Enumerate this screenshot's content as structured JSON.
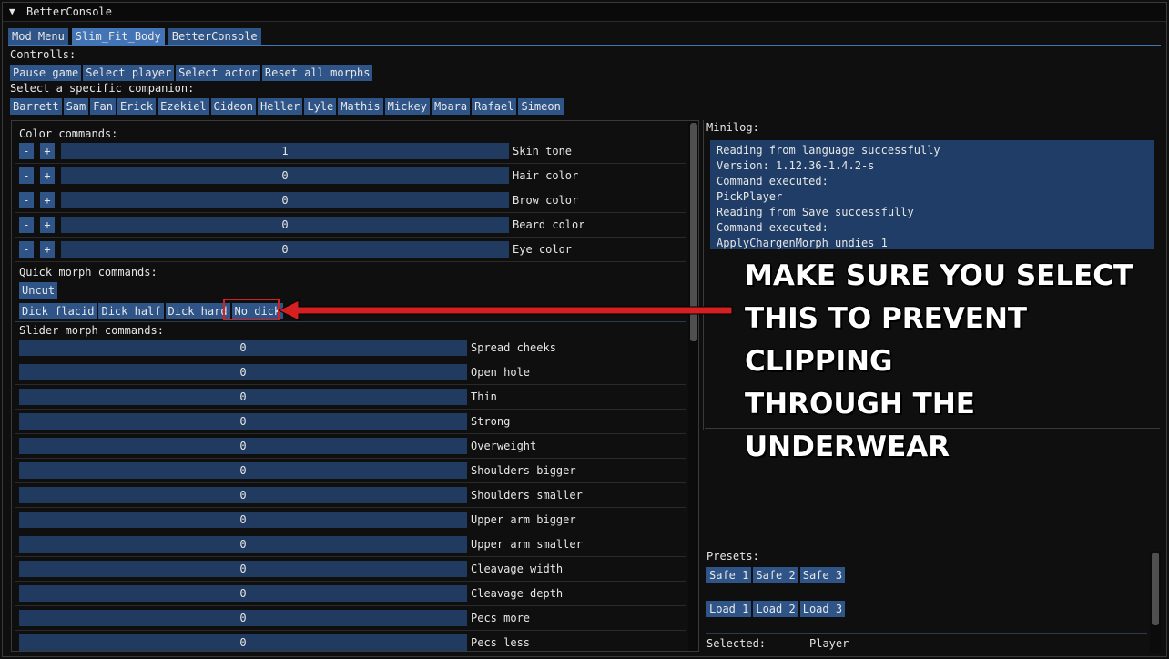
{
  "window": {
    "title": "BetterConsole",
    "collapse_icon": "triangle-down-icon"
  },
  "tabs": [
    {
      "label": "Mod Menu",
      "active": false
    },
    {
      "label": "Slim_Fit_Body",
      "active": true
    },
    {
      "label": "BetterConsole",
      "active": false
    }
  ],
  "controls": {
    "heading": "Controlls:",
    "buttons": [
      "Pause game",
      "Select player",
      "Select actor",
      "Reset all morphs"
    ],
    "companion_heading": "Select a specific companion:",
    "companions": [
      "Barrett",
      "Sam",
      "Fan",
      "Erick",
      "Ezekiel",
      "Gideon",
      "Heller",
      "Lyle",
      "Mathis",
      "Mickey",
      "Moara",
      "Rafael",
      "Simeon"
    ]
  },
  "color_section": {
    "heading": "Color commands:",
    "minus": "-",
    "plus": "+",
    "rows": [
      {
        "value": "1",
        "label": "Skin tone"
      },
      {
        "value": "0",
        "label": "Hair color"
      },
      {
        "value": "0",
        "label": "Brow color"
      },
      {
        "value": "0",
        "label": "Beard color"
      },
      {
        "value": "0",
        "label": "Eye color"
      }
    ]
  },
  "quick_morph": {
    "heading": "Quick morph commands:",
    "uncut": "Uncut",
    "buttons": [
      "Dick flacid",
      "Dick half",
      "Dick hard",
      "No dick"
    ]
  },
  "slider_section": {
    "heading": "Slider morph commands:",
    "rows": [
      {
        "value": "0",
        "label": "Spread cheeks"
      },
      {
        "value": "0",
        "label": "Open hole"
      },
      {
        "value": "0",
        "label": "Thin"
      },
      {
        "value": "0",
        "label": "Strong"
      },
      {
        "value": "0",
        "label": "Overweight"
      },
      {
        "value": "0",
        "label": "Shoulders bigger"
      },
      {
        "value": "0",
        "label": "Shoulders smaller"
      },
      {
        "value": "0",
        "label": "Upper arm bigger"
      },
      {
        "value": "0",
        "label": "Upper arm smaller"
      },
      {
        "value": "0",
        "label": "Cleavage width"
      },
      {
        "value": "0",
        "label": "Cleavage depth"
      },
      {
        "value": "0",
        "label": "Pecs more"
      },
      {
        "value": "0",
        "label": "Pecs less"
      }
    ]
  },
  "minilog": {
    "heading": "Minilog:",
    "lines": [
      "Reading from language successfully",
      "Version: 1.12.36-1.4.2-s",
      "Command executed:",
      "PickPlayer",
      "Reading from Save successfully",
      "Command executed:",
      "ApplyChargenMorph undies 1"
    ]
  },
  "presets": {
    "heading": "Presets:",
    "safe": [
      "Safe 1",
      "Safe 2",
      "Safe 3"
    ],
    "load": [
      "Load 1",
      "Load 2",
      "Load 3"
    ],
    "selected_label": "Selected:",
    "selected_value": "Player"
  },
  "annotation": {
    "lines": [
      "MAKE SURE YOU SELECT",
      "THIS TO PREVENT CLIPPING",
      "THROUGH THE UNDERWEAR"
    ],
    "color": "#d42020"
  },
  "colors": {
    "button": "#2e5488",
    "button_active": "#4374b5",
    "bar": "#203a60",
    "log_bg": "#1f3d66"
  }
}
